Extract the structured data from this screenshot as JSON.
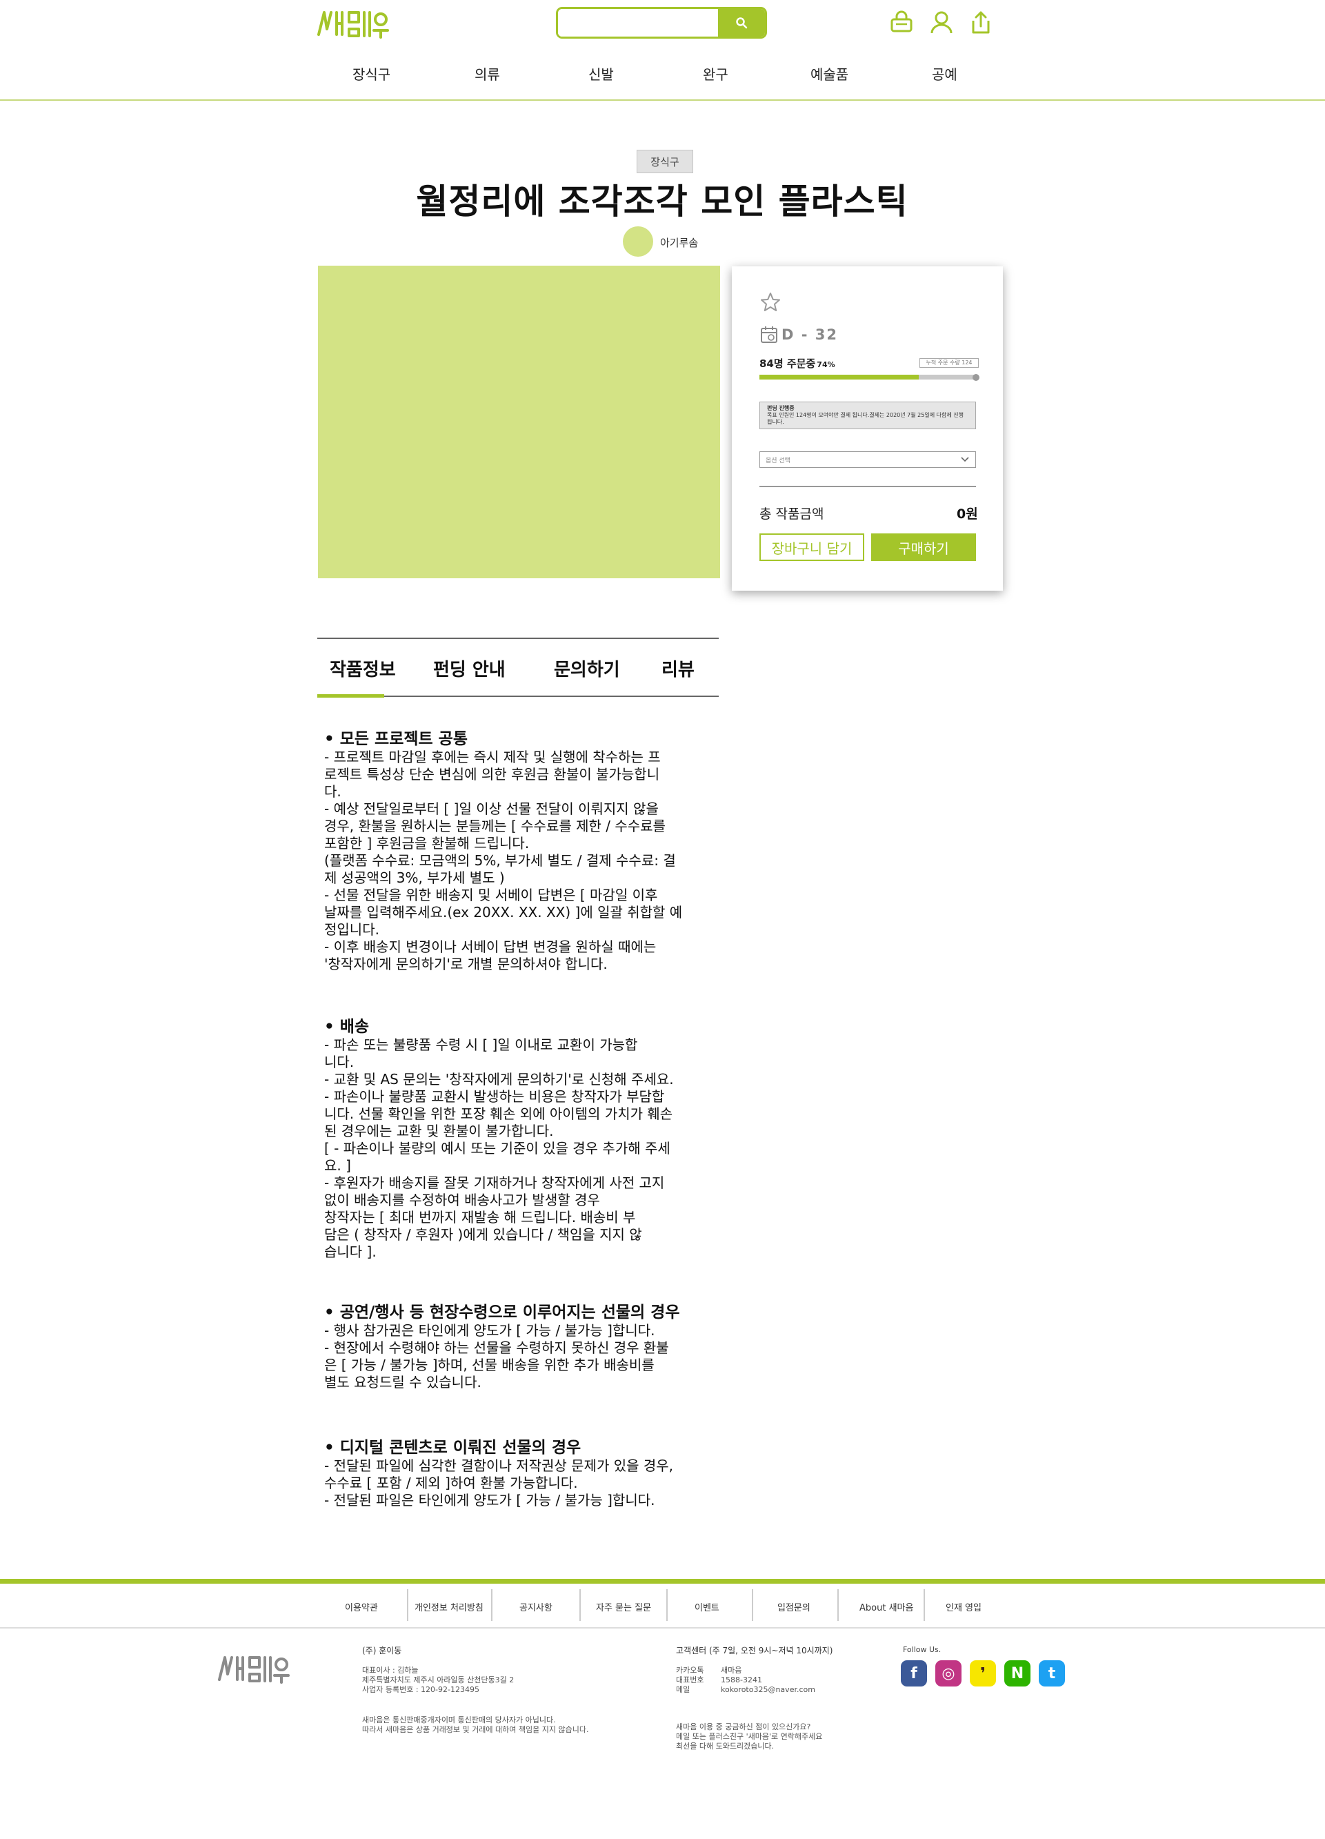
{
  "brand": {
    "name": "새마음",
    "accent": "#a4c52a",
    "light_accent": "#d3e385"
  },
  "header": {
    "search_placeholder": "",
    "icons": [
      "cart-icon",
      "user-icon",
      "share-icon"
    ],
    "nav": [
      "장식구",
      "의류",
      "신발",
      "완구",
      "예술품",
      "공예"
    ]
  },
  "product": {
    "category": "장식구",
    "title": "월정리에 조각조각 모인 플라스틱",
    "creator": "아기루솜"
  },
  "panel": {
    "dday": "D - 32",
    "orders": "84명 주문중",
    "percent": "74%",
    "progress": 0.74,
    "goal": "누적 주문 수량 124",
    "notice_title": "펀딩 진행중",
    "notice_body": "목표 인원인 124명이 모여야만 결제 됩니다.결제는 2020년 7월 25일에 다함께 진행됩니다.",
    "option_placeholder": "옵션 선택",
    "total_label": "총 작품금액",
    "total_value": "0원",
    "cart_button": "장바구니 담기",
    "buy_button": "구매하기"
  },
  "tabs": [
    "작품정보",
    "펀딩 안내",
    "문의하기",
    "리뷰"
  ],
  "sections": [
    {
      "title": "• 모든 프로젝트 공통",
      "body": "- 프로젝트 마감일 후에는 즉시 제작 및 실행에 착수하는 프\n로젝트 특성상 단순 변심에 의한 후원금 환불이 불가능합니\n다.\n- 예상 전달일로부터 [     ]일 이상 선물 전달이 이뤄지지 않을\n 경우, 환불을 원하시는 분들께는 [ 수수료를 제한 / 수수료를\n 포함한 ] 후원금을 환불해 드립니다.\n(플랫폼 수수료: 모금액의 5%, 부가세 별도 / 결제 수수료: 결\n제 성공액의 3%, 부가세 별도 )\n- 선물 전달을 위한 배송지 및 서베이 답변은 [    마감일 이후\n날짜를 입력해주세요.(ex 20XX. XX. XX)    ]에 일괄 취합할 예\n정입니다.\n- 이후 배송지 변경이나 서베이 답변 변경을 원하실 때에는\n'창작자에게 문의하기'로 개별 문의하셔야 합니다."
    },
    {
      "title": "• 배송",
      "body": "- 파손 또는 불량품 수령 시 [           ]일 이내로 교환이 가능합\n니다.\n- 교환 및 AS 문의는 '창작자에게 문의하기'로 신청해 주세요.\n- 파손이나 불량품 교환시 발생하는 비용은 창작자가 부담합\n니다. 선물 확인을 위한 포장 훼손 외에 아이템의 가치가 훼손\n된 경우에는 교환 및 환불이 불가합니다.\n[ - 파손이나 불량의 예시 또는 기준이 있을 경우 추가해 주세\n요. ]\n- 후원자가 배송지를 잘못 기재하거나 창작자에게 사전 고지\n없이 배송지를 수정하여 배송사고가 발생할 경우\n창작자는 [   최대        번까지 재발송 해 드립니다. 배송비 부\n담은 (   창작자 / 후원자   )에게 있습니다    /    책임을 지지 않\n습니다   ]."
    },
    {
      "title": "• 공연/행사 등 현장수령으로 이루어지는 선물의 경우",
      "body": "- 행사 참가권은 타인에게 양도가 [   가능   /   불가능   ]합니다.\n- 현장에서 수령해야 하는 선물을 수령하지 못하신 경우 환불\n은 [   가능    /   불가능   ]하며, 선물 배송을 위한 추가 배송비를\n 별도 요청드릴 수 있습니다."
    },
    {
      "title": "• 디지털 콘텐츠로 이뤄진 선물의 경우",
      "body": "- 전달된 파일에 심각한 결함이나 저작권상 문제가 있을 경우,\n 수수료 [   포함   /   제외   ]하여 환불 가능합니다.\n- 전달된 파일은 타인에게 양도가 [   가능   /   불가능   ]합니다."
    }
  ],
  "footer": {
    "links": [
      "이용약관",
      "개인정보 처리방침",
      "공지사항",
      "자주 묻는 질문",
      "이벤트",
      "입점문의",
      "About 새마음",
      "인재 영입"
    ],
    "company": "(주) 훈이동",
    "company_info": "대표이사 : 김하늘\n제주특별자치도 제주시 아라일동 산천단동3길 2\n사업자 등록번호 : 120-92-123495",
    "company_note": "새마음은 통신판매중개자이며 통신판매의 당사자가 아닙니다.\n따라서 새마음은 상품 거래정보 및 거래에 대하여 책임을 지지 않습니다.",
    "cs_title": "고객센터 (주 7일, 오전 9시~저녁 10시까지)",
    "cs_labels": "카카오톡\n대표번호\n메일",
    "cs_values": "새마음\n1588-3241\nkokoroto325@naver.com",
    "cs_note": "새마음 이용 중 궁금하신 점이 있으신가요?\n메일 또는 플러스친구 '새마음'로 연락해주세요\n최선을 다해 도와드리겠습니다.",
    "follow": "Follow Us.",
    "sns": [
      {
        "name": "facebook-icon",
        "color": "#3b5998",
        "glyph": "f"
      },
      {
        "name": "instagram-icon",
        "color": "#c13584",
        "glyph": "◎"
      },
      {
        "name": "kakaotalk-icon",
        "color": "#f7e600",
        "glyph": "❜"
      },
      {
        "name": "naver-icon",
        "color": "#2db400",
        "glyph": "N"
      },
      {
        "name": "twitter-icon",
        "color": "#1da1f2",
        "glyph": "t"
      }
    ]
  }
}
